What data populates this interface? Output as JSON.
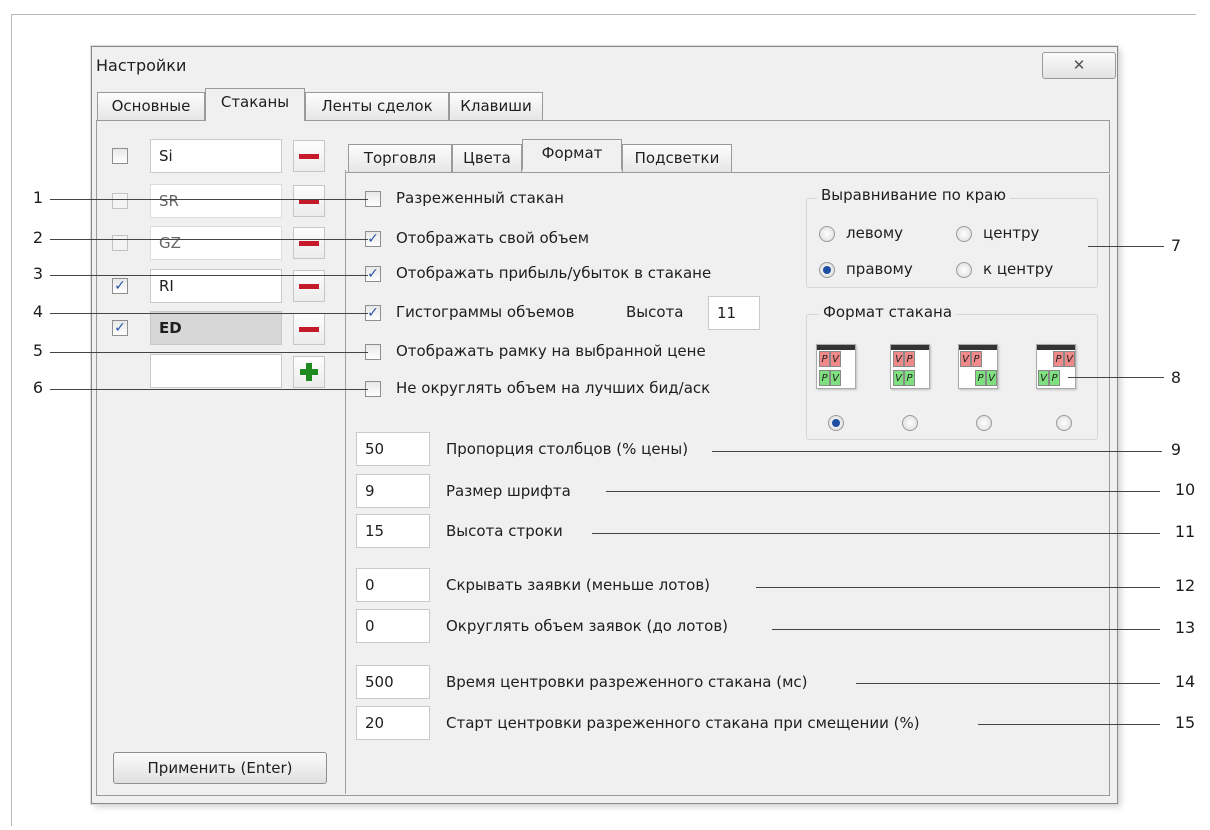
{
  "window": {
    "title": "Настройки",
    "close_icon": "✕"
  },
  "tabs": [
    "Основные",
    "Стаканы",
    "Ленты сделок",
    "Клавиши"
  ],
  "subtabs": [
    "Торговля",
    "Цвета",
    "Формат",
    "Подсветки"
  ],
  "instruments": [
    {
      "name": "Si",
      "checked": false
    },
    {
      "name": "SR",
      "checked": false
    },
    {
      "name": "GZ",
      "checked": false
    },
    {
      "name": "RI",
      "checked": true
    },
    {
      "name": "ED",
      "checked": true
    },
    {
      "name": "",
      "checked": false
    }
  ],
  "checks": [
    {
      "label": "Разреженный стакан",
      "checked": false
    },
    {
      "label": "Отображать свой объем",
      "checked": true
    },
    {
      "label": "Отображать прибыль/убыток в стакане",
      "checked": true
    },
    {
      "label": "Гистограммы объемов",
      "checked": true
    },
    {
      "label": "Отображать рамку на выбранной цене",
      "checked": false
    },
    {
      "label": "Не округлять объем на лучших бид/аск",
      "checked": false
    }
  ],
  "height": {
    "label": "Высота",
    "value": "11"
  },
  "align_group": {
    "title": "Выравнивание по краю",
    "options": [
      "левому",
      "центру",
      "правому",
      "к центру"
    ],
    "selected": "правому"
  },
  "format_group": {
    "title": "Формат стакана",
    "cell_labels": {
      "price": "P",
      "volume": "V"
    },
    "selected_index": 0
  },
  "params": [
    {
      "value": "50",
      "label": "Пропорция столбцов (% цены)"
    },
    {
      "value": "9",
      "label": "Размер шрифта"
    },
    {
      "value": "15",
      "label": "Высота строки"
    },
    {
      "value": "0",
      "label": "Скрывать заявки (меньше лотов)"
    },
    {
      "value": "0",
      "label": "Округлять объем заявок (до лотов)"
    },
    {
      "value": "500",
      "label": "Время центровки разреженного стакана (мс)"
    },
    {
      "value": "20",
      "label": "Старт центровки разреженного стакана при смещении (%)"
    }
  ],
  "apply_button": "Применить (Enter)",
  "callouts": [
    "1",
    "2",
    "3",
    "4",
    "5",
    "6",
    "7",
    "8",
    "9",
    "10",
    "11",
    "12",
    "13",
    "14",
    "15"
  ],
  "colors": {
    "minus": "#c41a2a",
    "plus": "#1f8a1f",
    "ask": "#f08a8a",
    "bid": "#7ee07e",
    "check": "#2b55a8"
  }
}
